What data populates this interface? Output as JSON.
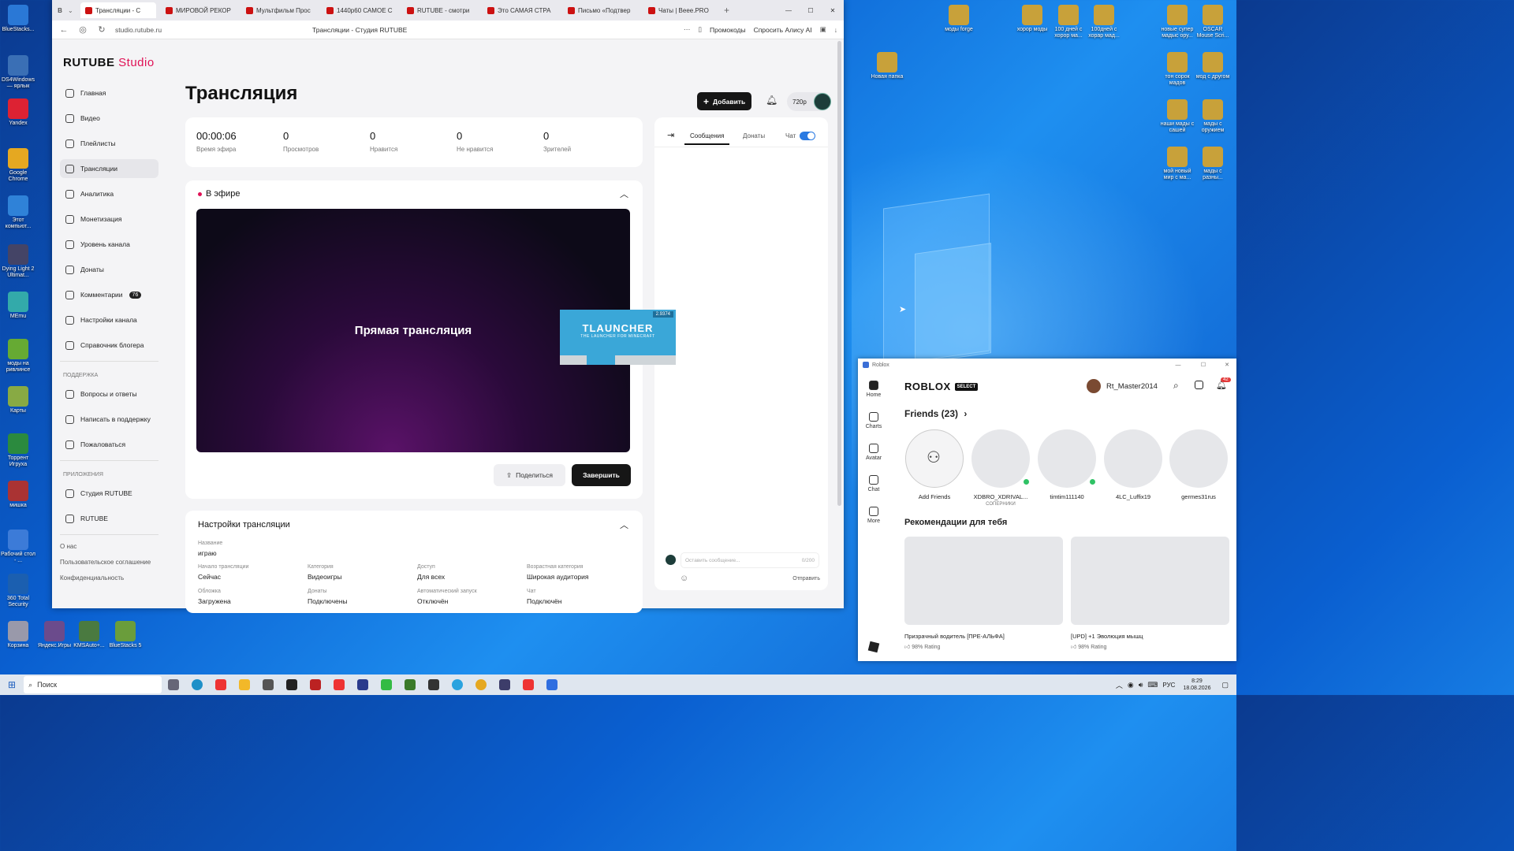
{
  "browser": {
    "tabs": [
      {
        "label": "Трансляции - С",
        "active": true
      },
      {
        "label": "МИРОВОЙ РЕКОР"
      },
      {
        "label": "Мультфильм Прос"
      },
      {
        "label": "1440p60 САМОЕ С"
      },
      {
        "label": "RUTUBE - смотри"
      },
      {
        "label": "Это САМАЯ СТРА"
      },
      {
        "label": "Письмо «Подтвер"
      },
      {
        "label": "Чаты | Beee.PRO"
      }
    ],
    "url": "studio.rutube.ru",
    "page_title": "Трансляции - Студия RUTUBE",
    "promo_label": "Промокоды",
    "alice_label": "Спросить Алису AI"
  },
  "studio": {
    "logo_main": "RUTUBE",
    "logo_suffix": "Studio",
    "add_label": "Добавить",
    "quality": "720p",
    "title": "Трансляция",
    "sidebar": [
      {
        "label": "Главная"
      },
      {
        "label": "Видео"
      },
      {
        "label": "Плейлисты"
      },
      {
        "label": "Трансляции",
        "active": true
      },
      {
        "label": "Аналитика"
      },
      {
        "label": "Монетизация"
      },
      {
        "label": "Уровень канала"
      },
      {
        "label": "Донаты"
      },
      {
        "label": "Комментарии",
        "badge": "76"
      },
      {
        "label": "Настройки канала"
      },
      {
        "label": "Справочник блогера"
      }
    ],
    "support_head": "ПОДДЕРЖКА",
    "support": [
      {
        "label": "Вопросы и ответы"
      },
      {
        "label": "Написать в поддержку"
      },
      {
        "label": "Пожаловаться"
      }
    ],
    "apps_head": "ПРИЛОЖЕНИЯ",
    "apps": [
      {
        "label": "Студия RUTUBE"
      },
      {
        "label": "RUTUBE"
      }
    ],
    "footer": [
      "О нас",
      "Пользовательское соглашение",
      "Конфиденциальность"
    ],
    "stats": [
      {
        "value": "00:00:06",
        "label": "Время эфира"
      },
      {
        "value": "0",
        "label": "Просмотров"
      },
      {
        "value": "0",
        "label": "Нравится"
      },
      {
        "value": "0",
        "label": "Не нравится"
      },
      {
        "value": "0",
        "label": "Зрителей"
      }
    ],
    "live_label": "В эфире",
    "player_text": "Прямая трансляция",
    "share_label": "Поделиться",
    "finish_label": "Завершить",
    "settings_title": "Настройки трансляции",
    "settings": {
      "name_key": "Название",
      "name_val": "играю",
      "fields": [
        {
          "k": "Начало трансляции",
          "v": "Сейчас"
        },
        {
          "k": "Категория",
          "v": "Видеоигры"
        },
        {
          "k": "Доступ",
          "v": "Для всех"
        },
        {
          "k": "Возрастная категория",
          "v": "Широкая аудитория"
        },
        {
          "k": "Обложка",
          "v": "Загружена"
        },
        {
          "k": "Донаты",
          "v": "Подключены"
        },
        {
          "k": "Автоматический запуск",
          "v": "Отключён"
        },
        {
          "k": "Чат",
          "v": "Подключён"
        }
      ]
    },
    "chat": {
      "tab_messages": "Сообщения",
      "tab_donations": "Донаты",
      "chat_toggle": "Чат",
      "input_placeholder": "Оставить сообщение...",
      "counter": "0/200",
      "send": "Отправить"
    }
  },
  "overlay": {
    "title": "TLAUNCHER",
    "subtitle": "THE LAUNCHER FOR MINECRAFT",
    "version": "2.9374"
  },
  "roblox": {
    "window_title": "Roblox",
    "brand": "ROBLOX",
    "select_badge": "SELECT",
    "username": "Rt_Master2014",
    "notif_count": "42",
    "nav": [
      "Home",
      "Charts",
      "Avatar",
      "Chat",
      "More"
    ],
    "friends_title": "Friends (23)",
    "friends": [
      {
        "name": "Add Friends",
        "sub": "",
        "online": false
      },
      {
        "name": "XDBRO_XDRIVAL...",
        "sub": "СОПЕРНИКИ",
        "online": true
      },
      {
        "name": "timtim111140",
        "sub": "",
        "online": true
      },
      {
        "name": "4LC_Luffix19",
        "sub": "",
        "online": false
      },
      {
        "name": "germes31rus",
        "sub": "",
        "online": false
      }
    ],
    "rec_title": "Рекомендации для тебя",
    "recs": [
      {
        "title": "Призрачный водитель [ПРЕ-АЛЬФА]",
        "rating": "98% Rating"
      },
      {
        "title": "[UPD] +1 Эволюция мышц",
        "rating": "98% Rating"
      }
    ]
  },
  "desktop_icons": [
    {
      "label": "BlueStacks..."
    },
    {
      "label": "DS4Windows — ярлык"
    },
    {
      "label": "Yandex"
    },
    {
      "label": "Google Chrome"
    },
    {
      "label": "Этот компьют..."
    },
    {
      "label": "Dying Light 2 Ultimat..."
    },
    {
      "label": "MEmu"
    },
    {
      "label": "моды на ривлинсе"
    },
    {
      "label": "Карты"
    },
    {
      "label": "Торрент Игруха"
    },
    {
      "label": "мишка"
    },
    {
      "label": "Рабочий стол - ..."
    },
    {
      "label": "360 Total Security"
    },
    {
      "label": "Корзина"
    },
    {
      "label": "Яндекс.Игры"
    },
    {
      "label": "KMSAuto+..."
    },
    {
      "label": "BlueStacks 5"
    },
    {
      "label": "моды forge"
    },
    {
      "label": "хорор моды"
    },
    {
      "label": "100 дней с хорор ма..."
    },
    {
      "label": "100дней с хорар мад..."
    },
    {
      "label": "новые супер мадыс ору..."
    },
    {
      "label": "OSCAR Mouse Scri..."
    },
    {
      "label": "Новая папка"
    },
    {
      "label": "тон сорок мадов"
    },
    {
      "label": "мод с другом"
    },
    {
      "label": "наши мады с сашей"
    },
    {
      "label": "мады с оружием"
    },
    {
      "label": "мой новый мир с ма..."
    },
    {
      "label": "мады с разны..."
    }
  ],
  "taskbar": {
    "search": "Поиск",
    "lang": "РУС",
    "time": "8:29",
    "date": "18.08.2026"
  }
}
